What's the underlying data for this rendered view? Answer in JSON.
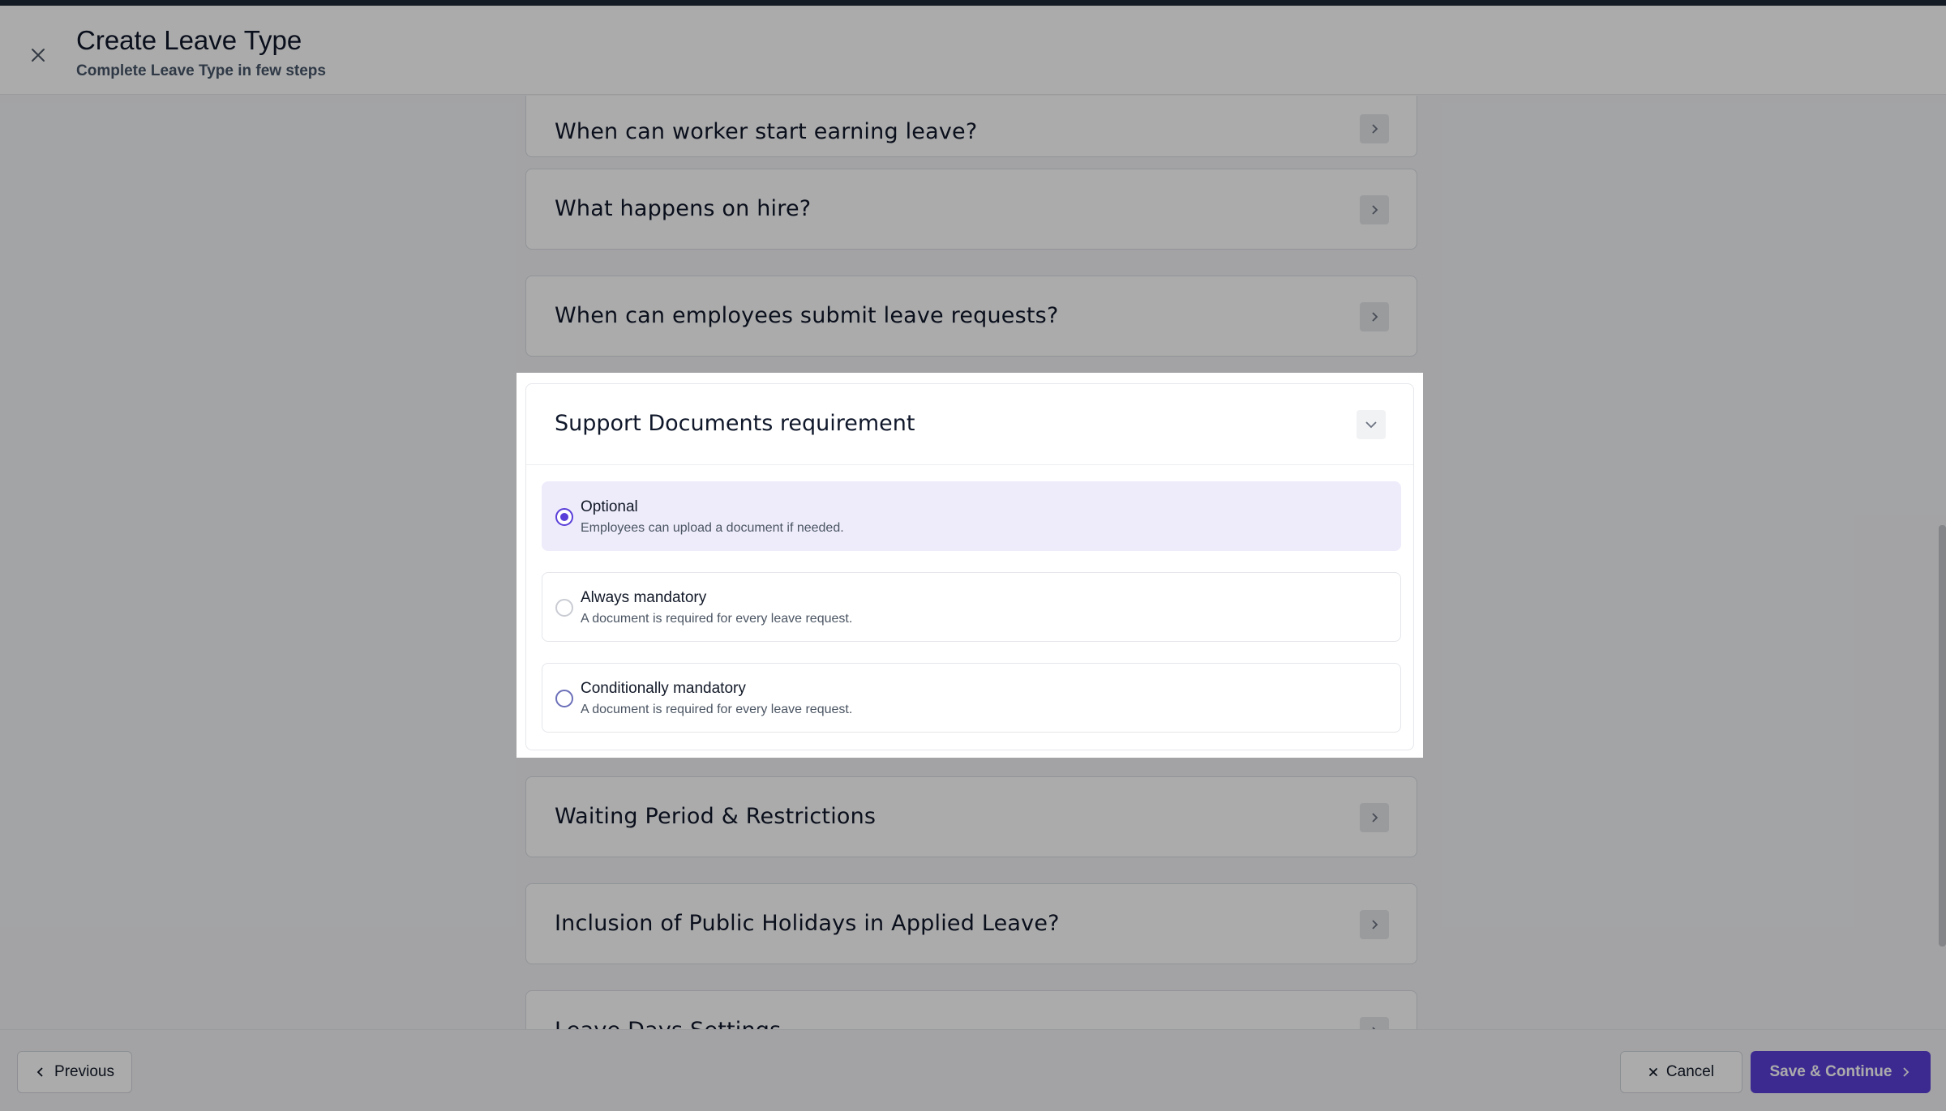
{
  "header": {
    "title": "Create Leave Type",
    "subtitle": "Complete Leave Type in few steps",
    "close_icon": "close-icon"
  },
  "sections": {
    "earning": "When can worker start earning leave?",
    "hire": "What happens on hire?",
    "submit": "When can employees submit leave requests?",
    "waiting": "Waiting Period & Restrictions",
    "holidays": "Inclusion of Public Holidays in Applied Leave?",
    "leave_days": "Leave Days Settings"
  },
  "support_documents": {
    "title": "Support Documents requirement",
    "options": [
      {
        "label": "Optional",
        "description": "Employees can upload a document if needed.",
        "selected": true
      },
      {
        "label": "Always mandatory",
        "description": "A document is required for every leave request.",
        "selected": false
      },
      {
        "label": "Conditionally mandatory",
        "description": "A document is required for every leave request.",
        "selected": false
      }
    ]
  },
  "footer": {
    "previous_label": "Previous",
    "cancel_label": "Cancel",
    "save_label": "Save & Continue"
  },
  "colors": {
    "accent": "#5b3fd9",
    "selected_bg": "#eeecfb"
  }
}
